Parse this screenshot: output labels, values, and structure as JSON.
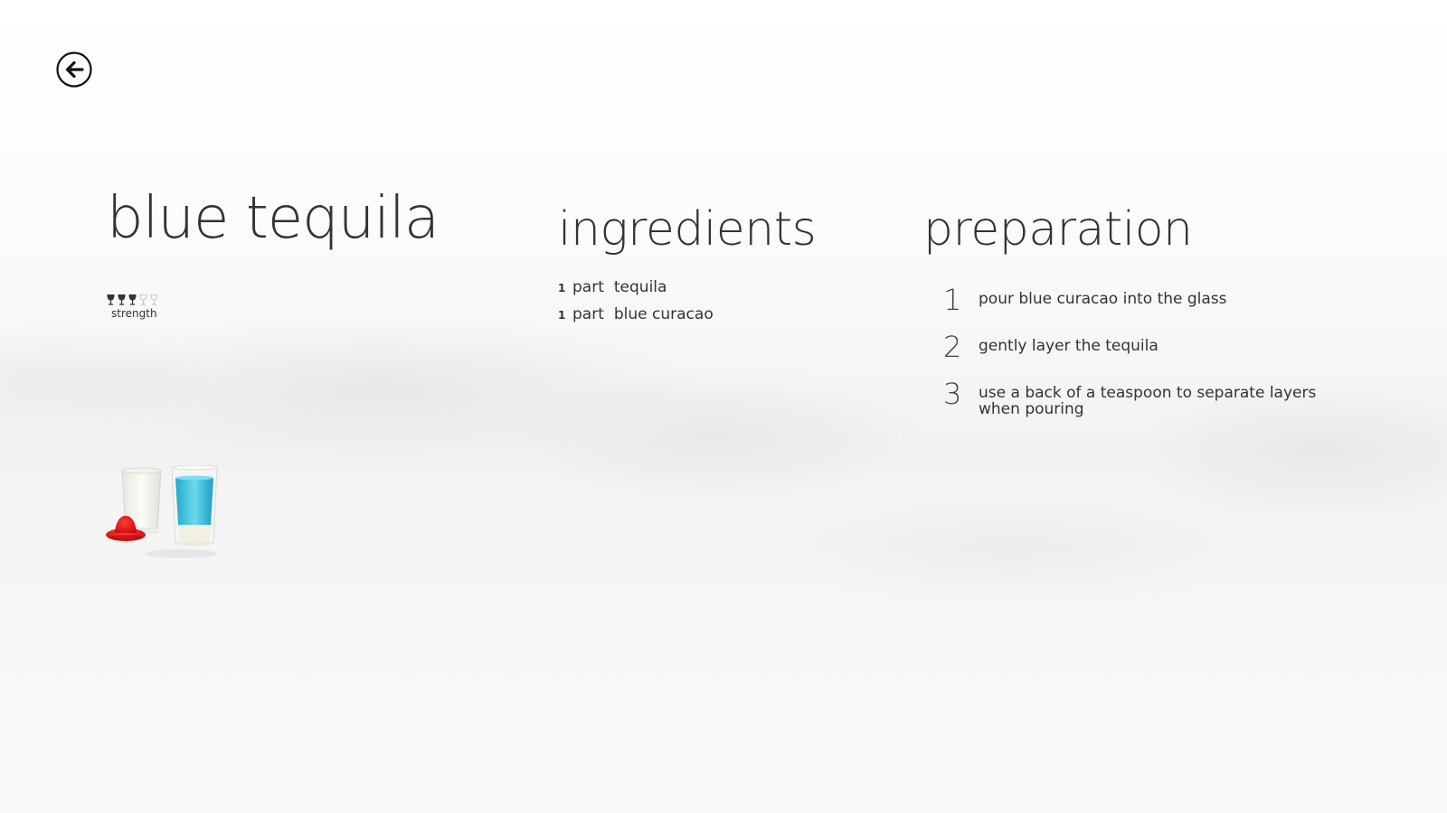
{
  "drink": {
    "title": "blue tequila",
    "strength": {
      "label": "strength",
      "level": 3,
      "max": 5
    }
  },
  "ingredients": {
    "heading": "ingredients",
    "items": [
      {
        "qty": "1",
        "unit": "part",
        "name": "tequila"
      },
      {
        "qty": "1",
        "unit": "part",
        "name": "blue curacao"
      }
    ]
  },
  "preparation": {
    "heading": "preparation",
    "steps": [
      {
        "num": "1",
        "text": "pour blue curacao into the glass"
      },
      {
        "num": "2",
        "text": "gently layer the tequila"
      },
      {
        "num": "3",
        "text": "use a back of a teaspoon to separate layers when pouring"
      }
    ]
  },
  "icons": {
    "back": "back-arrow-icon",
    "strength": "wine-glass-icon"
  },
  "colors": {
    "text": "#333333",
    "blue_liquid": "#3cc3e0",
    "sombrero_red": "#e01818",
    "glass_filled": "#333333",
    "glass_empty": "#c8c8c8"
  }
}
